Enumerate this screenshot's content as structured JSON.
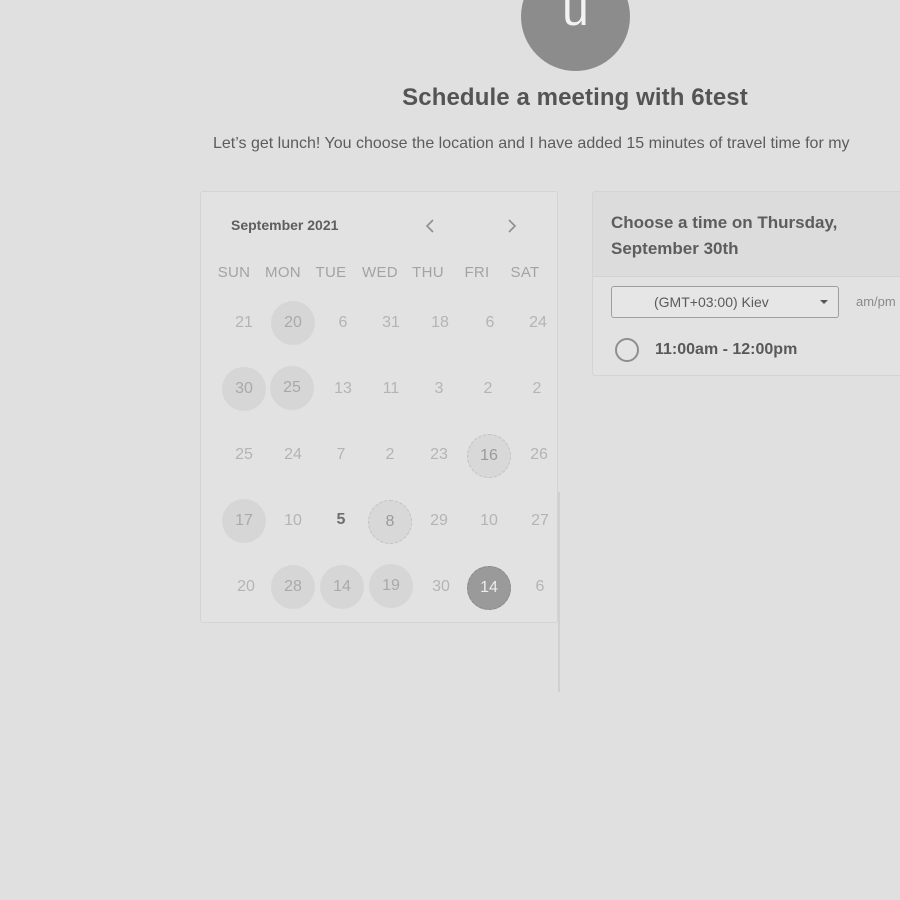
{
  "avatar": {
    "letter": "u"
  },
  "header": {
    "title": "Schedule a meeting with 6test",
    "subtitle": "Let’s get lunch! You choose the location and I have added 15 minutes of travel time for my"
  },
  "calendar": {
    "month_label": "September 2021",
    "prev_icon": "chevron-left-icon",
    "next_icon": "chevron-right-icon",
    "weekdays": [
      "SUN",
      "MON",
      "TUE",
      "WED",
      "THU",
      "FRI",
      "SAT"
    ],
    "weeks": [
      [
        "21",
        "20",
        "6",
        "31",
        "18",
        "6",
        "24"
      ],
      [
        "30",
        "25",
        "13",
        "11",
        "3",
        "2",
        "2"
      ],
      [
        "25",
        "24",
        "7",
        "2",
        "23",
        "16",
        "26"
      ],
      [
        "17",
        "10",
        "5",
        "8",
        "29",
        "10",
        "27"
      ],
      [
        "20",
        "28",
        "14",
        "19",
        "30",
        "14",
        "6"
      ]
    ]
  },
  "time_panel": {
    "title": "Choose a time on Thursday, September 30th",
    "timezone": "(GMT+03:00) Kiev",
    "format_label": "am/pm",
    "slots": [
      "11:00am - 12:00pm"
    ]
  }
}
